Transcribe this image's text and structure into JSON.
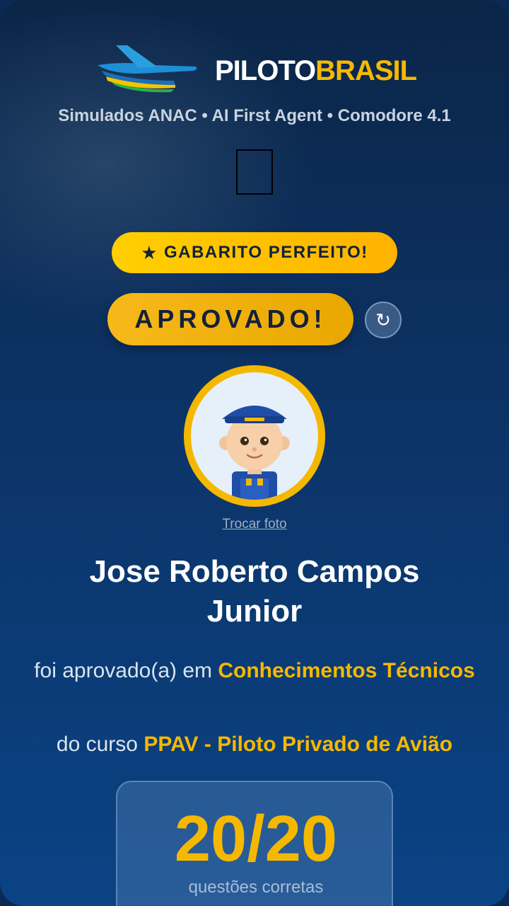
{
  "header": {
    "brand_part1": "PILOTO",
    "brand_part2": "BRASIL",
    "subtitle": "Simulados ANAC • AI First Agent • Comodore 4.1"
  },
  "badges": {
    "perfect_star": "★",
    "perfect_label": "GABARITO PERFEITO!",
    "approved_label": "APROVADO!",
    "refresh_symbol": "↻"
  },
  "profile": {
    "change_photo_label": "Trocar foto",
    "name": "Jose Roberto Campos Junior"
  },
  "result": {
    "approved_prefix": "foi aprovado(a) em",
    "subject": "Conhecimentos Técnicos",
    "course_prefix": "do curso",
    "course": "PPAV - Piloto Privado de Avião"
  },
  "score": {
    "value": "20/20",
    "label": "questões corretas"
  },
  "colors": {
    "accent": "#f5b800",
    "background_top": "#0b2547",
    "background_bottom": "#0a4385"
  }
}
